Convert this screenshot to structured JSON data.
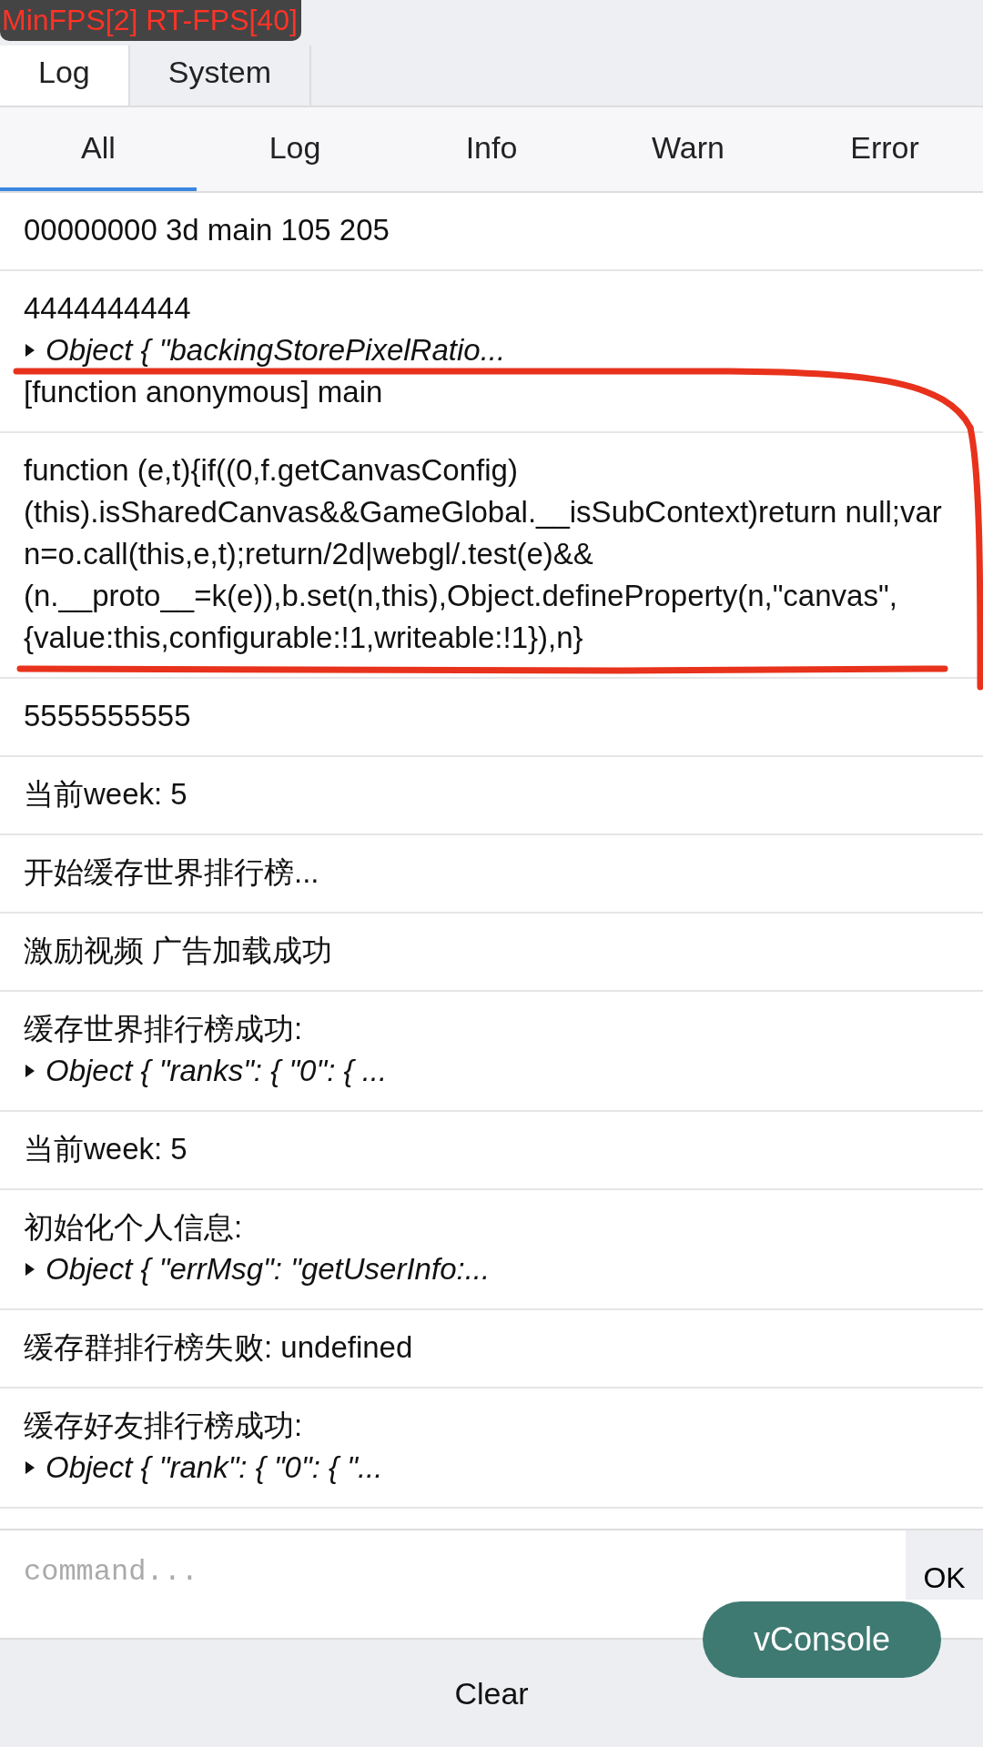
{
  "fps_badge": "MinFPS[2] RT-FPS[40]",
  "tabs": [
    {
      "label": "Log",
      "selected": true
    },
    {
      "label": "System",
      "selected": false
    }
  ],
  "filters": [
    {
      "label": "All",
      "selected": true
    },
    {
      "label": "Log",
      "selected": false
    },
    {
      "label": "Info",
      "selected": false
    },
    {
      "label": "Warn",
      "selected": false
    },
    {
      "label": "Error",
      "selected": false
    }
  ],
  "log_entries": [
    {
      "lines": [
        {
          "kind": "text",
          "text": "00000000 3d main 105 205"
        }
      ]
    },
    {
      "lines": [
        {
          "kind": "text",
          "text": "4444444444"
        },
        {
          "kind": "object",
          "text": "Object { \"backingStorePixelRatio..."
        },
        {
          "kind": "text",
          "text": "[function anonymous] main"
        }
      ]
    },
    {
      "lines": [
        {
          "kind": "text",
          "text": "function (e,t){if((0,f.getCanvasConfig)(this).isSharedCanvas&&GameGlobal.__isSubContext)return null;var n=o.call(this,e,t);return/2d|webgl/.test(e)&&(n.__proto__=k(e)),b.set(n,this),Object.defineProperty(n,\"canvas\",{value:this,configurable:!1,writeable:!1}),n}"
        }
      ]
    },
    {
      "lines": [
        {
          "kind": "text",
          "text": "5555555555"
        }
      ]
    },
    {
      "lines": [
        {
          "kind": "text",
          "text": "当前week: 5"
        }
      ]
    },
    {
      "lines": [
        {
          "kind": "text",
          "text": "开始缓存世界排行榜..."
        }
      ]
    },
    {
      "lines": [
        {
          "kind": "text",
          "text": "激励视频 广告加载成功"
        }
      ]
    },
    {
      "lines": [
        {
          "kind": "text",
          "text": "缓存世界排行榜成功:"
        },
        {
          "kind": "object",
          "text": "Object { \"ranks\": { \"0\": { ..."
        }
      ]
    },
    {
      "lines": [
        {
          "kind": "text",
          "text": "当前week: 5"
        }
      ]
    },
    {
      "lines": [
        {
          "kind": "text",
          "text": "初始化个人信息:"
        },
        {
          "kind": "object",
          "text": "Object { \"errMsg\": \"getUserInfo:..."
        }
      ]
    },
    {
      "lines": [
        {
          "kind": "text",
          "text": "缓存群排行榜失败: undefined"
        }
      ]
    },
    {
      "lines": [
        {
          "kind": "text",
          "text": "缓存好友排行榜成功:"
        },
        {
          "kind": "object",
          "text": "Object { \"rank\": { \"0\": { \"..."
        }
      ]
    }
  ],
  "command": {
    "placeholder": "command...",
    "button": "OK"
  },
  "clear_button": "Clear",
  "vconsole_button": "vConsole"
}
